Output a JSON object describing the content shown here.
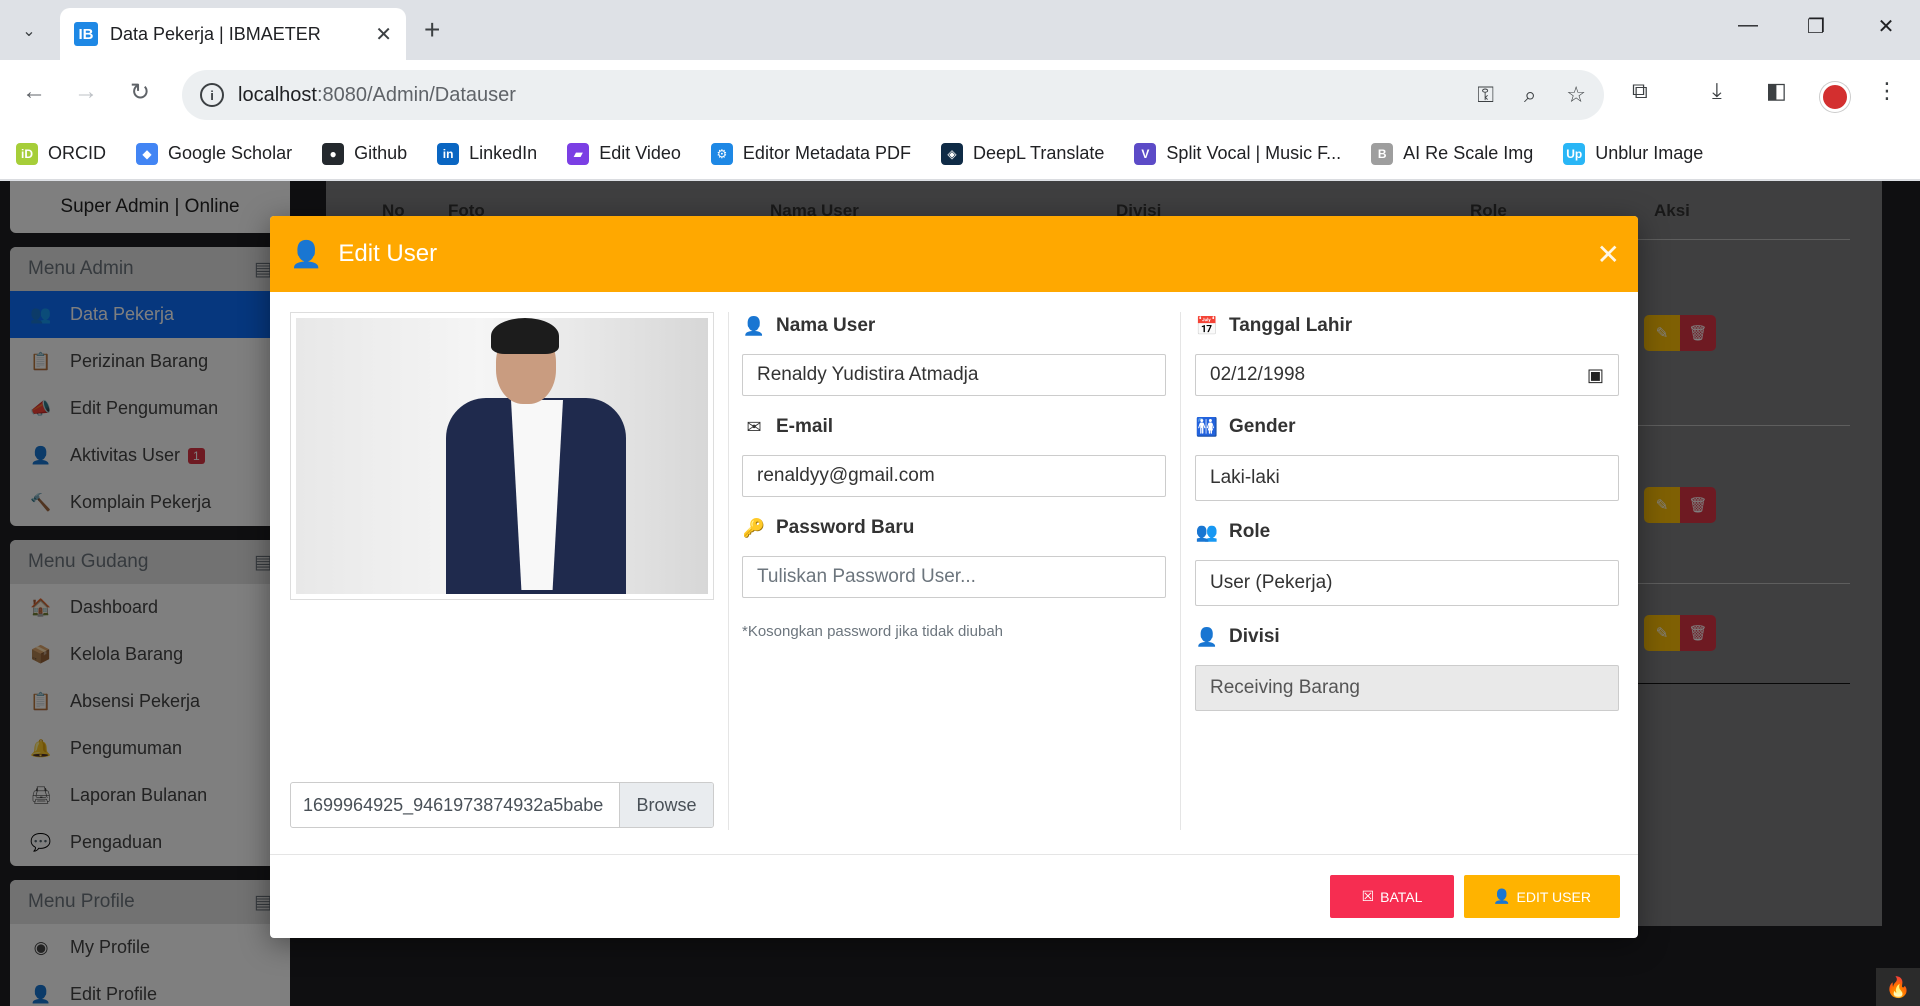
{
  "browser": {
    "tab_title": "Data Pekerja | IBMAETER",
    "tab_favicon": "IB",
    "url_host": "localhost",
    "url_rest": ":8080/Admin/Datauser",
    "bookmarks": [
      {
        "label": "ORCID",
        "color": "#a6ce39",
        "icon": "iD"
      },
      {
        "label": "Google Scholar",
        "color": "#4285f4",
        "icon": "◆"
      },
      {
        "label": "Github",
        "color": "#24292e",
        "icon": "●"
      },
      {
        "label": "LinkedIn",
        "color": "#0a66c2",
        "icon": "in"
      },
      {
        "label": "Edit Video",
        "color": "#7b3fe4",
        "icon": "▰"
      },
      {
        "label": "Editor Metadata PDF",
        "color": "#1e88e5",
        "icon": "⚙"
      },
      {
        "label": "DeepL Translate",
        "color": "#0f2b46",
        "icon": "◈"
      },
      {
        "label": "Split Vocal | Music F...",
        "color": "#5c4bc7",
        "icon": "V"
      },
      {
        "label": "AI Re Scale Img",
        "color": "#9e9e9e",
        "icon": "B"
      },
      {
        "label": "Unblur Image",
        "color": "#29b6f6",
        "icon": "Up"
      }
    ]
  },
  "sidebar": {
    "status": "Super Admin | Online",
    "groups": [
      {
        "title": "Menu Admin",
        "items": [
          {
            "label": "Data Pekerja",
            "icon": "users-icon",
            "glyph": "👥",
            "active": true
          },
          {
            "label": "Perizinan Barang",
            "icon": "clipboard-icon",
            "glyph": "📋"
          },
          {
            "label": "Edit Pengumuman",
            "icon": "megaphone-icon",
            "glyph": "📣"
          },
          {
            "label": "Aktivitas User",
            "icon": "activity-icon",
            "glyph": "👤",
            "badge": "1"
          },
          {
            "label": "Komplain Pekerja",
            "icon": "gavel-icon",
            "glyph": "🔨"
          }
        ]
      },
      {
        "title": "Menu Gudang",
        "items": [
          {
            "label": "Dashboard",
            "icon": "warehouse-icon",
            "glyph": "🏠"
          },
          {
            "label": "Kelola Barang",
            "icon": "box-icon",
            "glyph": "📦"
          },
          {
            "label": "Absensi Pekerja",
            "icon": "clipboard-icon",
            "glyph": "📋"
          },
          {
            "label": "Pengumuman",
            "icon": "bell-icon",
            "glyph": "🔔"
          },
          {
            "label": "Laporan Bulanan",
            "icon": "print-icon",
            "glyph": "🖨"
          },
          {
            "label": "Pengaduan",
            "icon": "chat-icon",
            "glyph": "💬"
          }
        ]
      },
      {
        "title": "Menu Profile",
        "items": [
          {
            "label": "My Profile",
            "icon": "user-circle-icon",
            "glyph": "◉"
          },
          {
            "label": "Edit Profile",
            "icon": "user-edit-icon",
            "glyph": "👤"
          }
        ]
      }
    ]
  },
  "table": {
    "headers": [
      "No",
      "Foto",
      "Nama User",
      "Divisi",
      "Role",
      "Aksi"
    ]
  },
  "modal": {
    "title": "Edit User",
    "file_name": "1699964925_9461973874932a5babe",
    "browse_label": "Browse",
    "fields": {
      "nama_label": "Nama User",
      "nama_value": "Renaldy Yudistira Atmadja",
      "email_label": "E-mail",
      "email_value": "renaldyy@gmail.com",
      "password_label": "Password Baru",
      "password_placeholder": "Tuliskan Password User...",
      "password_help": "*Kosongkan password jika tidak diubah",
      "tanggal_label": "Tanggal Lahir",
      "tanggal_value": "02/12/1998",
      "gender_label": "Gender",
      "gender_value": "Laki-laki",
      "role_label": "Role",
      "role_value": "User (Pekerja)",
      "divisi_label": "Divisi",
      "divisi_value": "Receiving Barang"
    },
    "buttons": {
      "batal": "BATAL",
      "edit_user": "EDIT USER"
    }
  },
  "colors": {
    "modal_header": "#ffa800",
    "batal_button": "#f62d51",
    "edit_button": "#ffb300",
    "sidebar_active": "#0d6efd"
  }
}
